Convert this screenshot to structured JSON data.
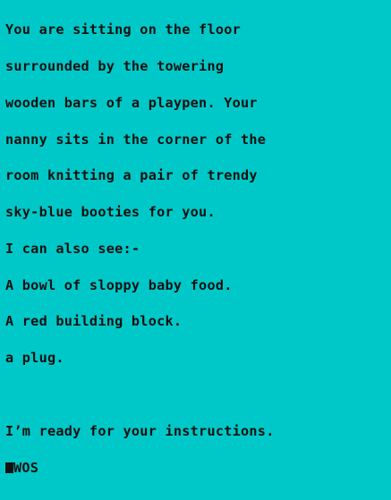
{
  "game": {
    "description_lines": [
      "You are sitting on the floor",
      "surrounded by the towering",
      "wooden bars of a playpen. Your",
      "nanny sits in the corner of the",
      "room knitting a pair of trendy",
      "sky-blue booties for you."
    ],
    "see_header": "I can also see:-",
    "items": [
      "A bowl of sloppy baby food.",
      "A red building block.",
      "a plug."
    ],
    "ready_message": "I’m ready for your instructions.",
    "input_value": "WOS",
    "colors": {
      "background": "#00c8c8",
      "text": "#111111"
    }
  }
}
